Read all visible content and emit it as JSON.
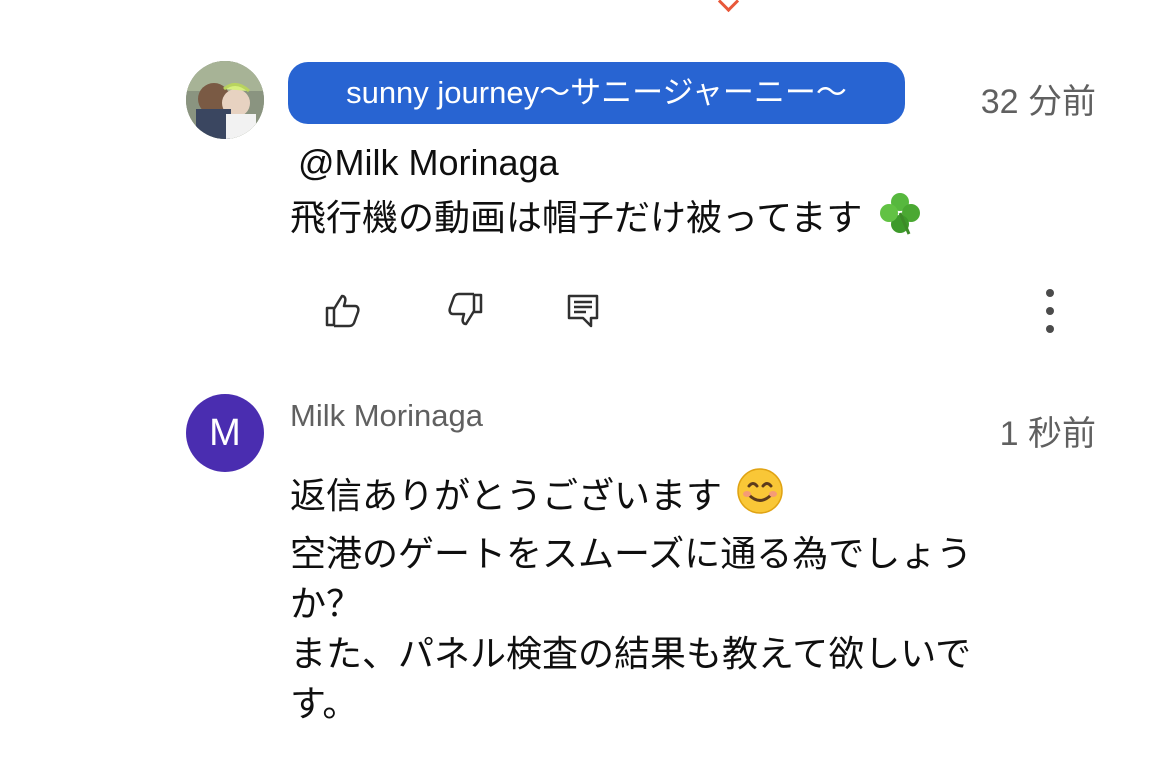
{
  "comments": [
    {
      "author": "sunny journey〜サニージャーニー〜",
      "time": "32 分前",
      "mention": "@Milk Morinaga",
      "text": "飛行機の動画は帽子だけ被ってます",
      "emoji": "four-leaf-clover"
    },
    {
      "author": "Milk Morinaga",
      "avatar_letter": "M",
      "time": "1 秒前",
      "lines": [
        "返信ありがとうございます",
        "空港のゲートをスムーズに通る為でしょう",
        "か？",
        "また、パネル検査の結果も教えて欲しいで",
        "す。"
      ],
      "emoji": "smiling-face"
    }
  ],
  "actions": {
    "icons": [
      "thumb-up-icon",
      "thumb-down-icon",
      "reply-icon",
      "more-vertical-icon"
    ]
  },
  "colors": {
    "author_pill": "#2864d2",
    "avatar_m": "#4a2db0",
    "meta_text": "#606060",
    "top_mark": "#e8583a"
  }
}
